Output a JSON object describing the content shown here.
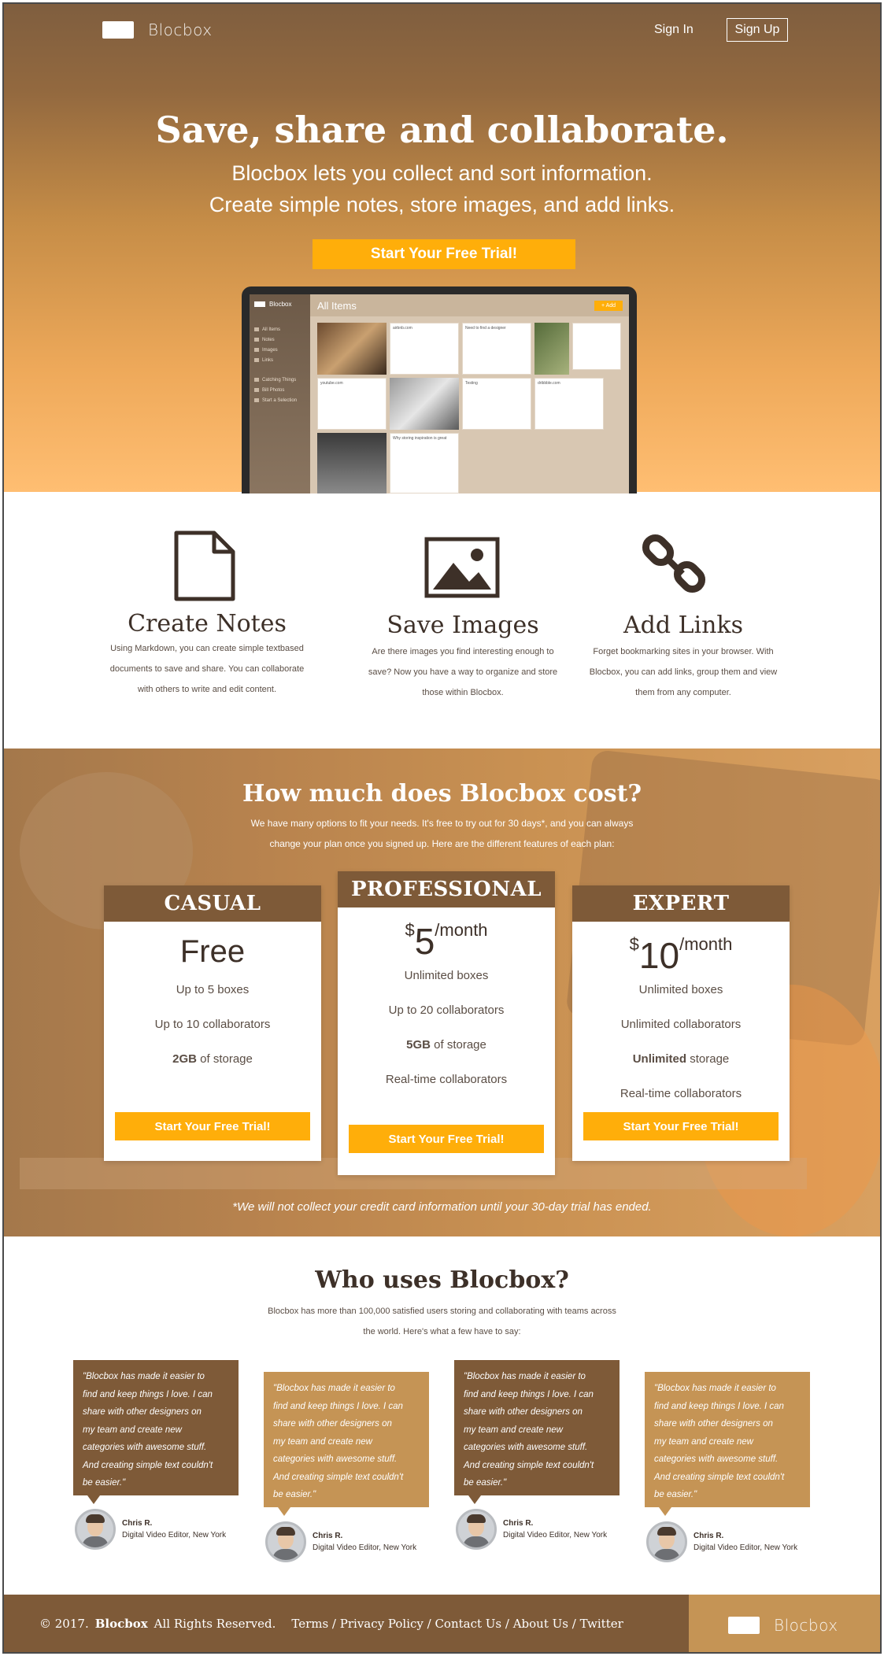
{
  "nav": {
    "logo": "Blocbox",
    "signin": "Sign In",
    "signup": "Sign Up"
  },
  "hero": {
    "title": "Save, share and collaborate.",
    "subtitle_line1": "Blocbox lets you collect and sort information.",
    "subtitle_line2": "Create simple notes, store images, and add links.",
    "cta": "Start Your Free Trial!"
  },
  "app_preview": {
    "logo": "Blocbox",
    "title": "All Items",
    "add": "+ Add",
    "sidebar_items": [
      "All Items",
      "Notes",
      "Images",
      "Links",
      "Catching Things",
      "Bill Photos",
      "Start a Selection"
    ],
    "cards": [
      "airbnb.com",
      "Need to find a designer",
      "youtube.com",
      "Testing",
      "dribbble.com",
      "Why storing inspiration is great"
    ]
  },
  "features": [
    {
      "title": "Create Notes",
      "line1": "Using Markdown, you can create simple textbased",
      "line2": "documents to save and share. You can collaborate",
      "line3": "with others to write and edit content."
    },
    {
      "title": "Save Images",
      "line1": "Are there images you find interesting enough to",
      "line2": "save? Now you have a way to organize and store",
      "line3": "those within Blocbox."
    },
    {
      "title": "Add Links",
      "line1": "Forget bookmarking sites in your browser. With",
      "line2": "Blocbox, you can add links, group them and view",
      "line3": "them from any computer."
    }
  ],
  "pricing": {
    "title": "How much does Blocbox cost?",
    "sub_line1": "We have many options to fit your needs. It's free to try out for 30 days*, and you can always",
    "sub_line2": "change your plan once you signed up. Here are the different features of each plan:",
    "plans": [
      {
        "name": "CASUAL",
        "price": "Free",
        "f1": "Up to 5 boxes",
        "f2": "Up to 10 collaborators",
        "f3_bold": "2GB",
        "f3_rest": " of storage",
        "cta": "Start Your Free Trial!"
      },
      {
        "name": "PROFESSIONAL",
        "currency": "$",
        "amount": "5",
        "per": "/month",
        "f1": "Unlimited boxes",
        "f2": "Up to 20 collaborators",
        "f3_bold": "5GB",
        "f3_rest": " of storage",
        "f4": "Real-time collaborators",
        "cta": "Start Your Free Trial!"
      },
      {
        "name": "EXPERT",
        "currency": "$",
        "amount": "10",
        "per": "/month",
        "f1": "Unlimited boxes",
        "f2": "Unlimited collaborators",
        "f3_bold": "Unlimited",
        "f3_rest": " storage",
        "f4": "Real-time collaborators",
        "cta": "Start Your Free Trial!"
      }
    ],
    "note": "*We will not collect your credit card information until your 30-day trial has ended."
  },
  "testimonials": {
    "title": "Who uses Blocbox?",
    "sub_line1": "Blocbox has more than 100,000 satisfied users storing and collaborating with teams across",
    "sub_line2": "the world. Here's what a few have to say:",
    "quote_lines": [
      "\"Blocbox has made it easier to",
      "find and keep things I love. I can",
      "share with other designers on",
      "my team and create new",
      "categories with awesome stuff.",
      "And creating simple text couldn't",
      "be easier.\""
    ],
    "author_name": "Chris R.",
    "author_role": "Digital Video Editor, New York"
  },
  "footer": {
    "copyright": "© 2017.",
    "brand": "Blocbox",
    "rights": "All Rights Reserved.",
    "links": "Terms / Privacy Policy / Contact Us / About Us / Twitter",
    "logo": "Blocbox"
  },
  "colors": {
    "brand_brown": "#7e5a38",
    "accent_orange": "#ffae0a",
    "light_tan": "#c59455"
  }
}
